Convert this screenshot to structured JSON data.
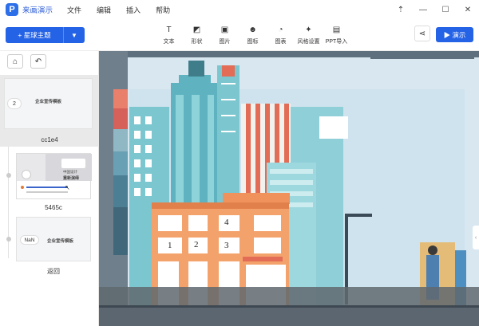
{
  "app": {
    "name": "来画演示",
    "logo": "P"
  },
  "menu": [
    "文件",
    "编辑",
    "插入",
    "帮助"
  ],
  "window_controls": {
    "pin": "⇡",
    "minimize": "—",
    "maximize": "☐",
    "close": "✕"
  },
  "toolbar": {
    "theme_label": "+ 星球主题",
    "theme_dropdown": "▼",
    "tools": [
      {
        "label": "文本",
        "icon": "T"
      },
      {
        "label": "形状",
        "icon": "◩"
      },
      {
        "label": "图片",
        "icon": "▣"
      },
      {
        "label": "图标",
        "icon": "☻"
      },
      {
        "label": "图表",
        "icon": "◔"
      },
      {
        "label": "风格设置",
        "icon": "✦"
      },
      {
        "label": "PPT导入",
        "icon": "▤"
      }
    ],
    "share_icon": "⋖",
    "present_label": "▶ 演示"
  },
  "sidebar": {
    "home_icon": "⌂",
    "back_icon": "↶",
    "slides": [
      {
        "number": "2",
        "title": "企业宣传模板",
        "caption": "cc1e4"
      },
      {
        "text_a": "中国设计",
        "text_b": "重新演绎",
        "caption": "5465c"
      },
      {
        "number": "NaN",
        "title": "企业宣传模板",
        "caption": "返回"
      }
    ]
  },
  "canvas": {
    "numbers": [
      "1",
      "2",
      "3",
      "4"
    ]
  },
  "colors": {
    "accent": "#2563e6",
    "sky": "#cfe3ee"
  }
}
